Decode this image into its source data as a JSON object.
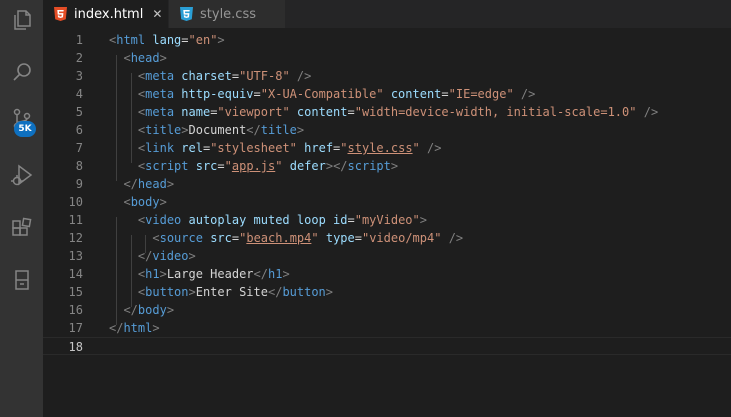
{
  "activity_bar": {
    "icons": [
      "explorer-icon",
      "search-icon",
      "source-control-icon",
      "run-debug-icon",
      "extensions-icon",
      "remote-explorer-icon"
    ],
    "source_control_badge": "5K"
  },
  "tabs": [
    {
      "label": "index.html",
      "icon": "html5-file-icon",
      "active": true,
      "icon_color": "#e44d26"
    },
    {
      "label": "style.css",
      "icon": "css3-file-icon",
      "active": false,
      "icon_color": "#2a9fd6"
    }
  ],
  "editor": {
    "current_line": 18,
    "lines": [
      {
        "n": "1",
        "tokens": [
          [
            "t-punc",
            "<"
          ],
          [
            "t-tag",
            "html"
          ],
          [
            "t-text",
            " "
          ],
          [
            "t-attr",
            "lang"
          ],
          [
            "t-text",
            "="
          ],
          [
            "t-str",
            "\"en\""
          ],
          [
            "t-punc",
            ">"
          ]
        ]
      },
      {
        "n": "2",
        "tokens": [
          [
            "t-text",
            "  "
          ],
          [
            "t-punc",
            "<"
          ],
          [
            "t-tag",
            "head"
          ],
          [
            "t-punc",
            ">"
          ]
        ]
      },
      {
        "n": "3",
        "tokens": [
          [
            "t-text",
            "    "
          ],
          [
            "t-punc",
            "<"
          ],
          [
            "t-tag",
            "meta"
          ],
          [
            "t-text",
            " "
          ],
          [
            "t-attr",
            "charset"
          ],
          [
            "t-text",
            "="
          ],
          [
            "t-str",
            "\"UTF-8\""
          ],
          [
            "t-text",
            " "
          ],
          [
            "t-punc",
            "/>"
          ]
        ]
      },
      {
        "n": "4",
        "tokens": [
          [
            "t-text",
            "    "
          ],
          [
            "t-punc",
            "<"
          ],
          [
            "t-tag",
            "meta"
          ],
          [
            "t-text",
            " "
          ],
          [
            "t-attr",
            "http-equiv"
          ],
          [
            "t-text",
            "="
          ],
          [
            "t-str",
            "\"X-UA-Compatible\""
          ],
          [
            "t-text",
            " "
          ],
          [
            "t-attr",
            "content"
          ],
          [
            "t-text",
            "="
          ],
          [
            "t-str",
            "\"IE=edge\""
          ],
          [
            "t-text",
            " "
          ],
          [
            "t-punc",
            "/>"
          ]
        ]
      },
      {
        "n": "5",
        "tokens": [
          [
            "t-text",
            "    "
          ],
          [
            "t-punc",
            "<"
          ],
          [
            "t-tag",
            "meta"
          ],
          [
            "t-text",
            " "
          ],
          [
            "t-attr",
            "name"
          ],
          [
            "t-text",
            "="
          ],
          [
            "t-str",
            "\"viewport\""
          ],
          [
            "t-text",
            " "
          ],
          [
            "t-attr",
            "content"
          ],
          [
            "t-text",
            "="
          ],
          [
            "t-str",
            "\"width=device-width, initial-scale=1.0\""
          ],
          [
            "t-text",
            " "
          ],
          [
            "t-punc",
            "/>"
          ]
        ]
      },
      {
        "n": "6",
        "tokens": [
          [
            "t-text",
            "    "
          ],
          [
            "t-punc",
            "<"
          ],
          [
            "t-tag",
            "title"
          ],
          [
            "t-punc",
            ">"
          ],
          [
            "t-text",
            "Document"
          ],
          [
            "t-punc",
            "</"
          ],
          [
            "t-tag",
            "title"
          ],
          [
            "t-punc",
            ">"
          ]
        ]
      },
      {
        "n": "7",
        "tokens": [
          [
            "t-text",
            "    "
          ],
          [
            "t-punc",
            "<"
          ],
          [
            "t-tag",
            "link"
          ],
          [
            "t-text",
            " "
          ],
          [
            "t-attr",
            "rel"
          ],
          [
            "t-text",
            "="
          ],
          [
            "t-str",
            "\"stylesheet\""
          ],
          [
            "t-text",
            " "
          ],
          [
            "t-attr",
            "href"
          ],
          [
            "t-text",
            "="
          ],
          [
            "t-str",
            "\""
          ],
          [
            "t-link",
            "style.css"
          ],
          [
            "t-str",
            "\""
          ],
          [
            "t-text",
            " "
          ],
          [
            "t-punc",
            "/>"
          ]
        ]
      },
      {
        "n": "8",
        "tokens": [
          [
            "t-text",
            "    "
          ],
          [
            "t-punc",
            "<"
          ],
          [
            "t-tag",
            "script"
          ],
          [
            "t-text",
            " "
          ],
          [
            "t-attr",
            "src"
          ],
          [
            "t-text",
            "="
          ],
          [
            "t-str",
            "\""
          ],
          [
            "t-link",
            "app.js"
          ],
          [
            "t-str",
            "\""
          ],
          [
            "t-text",
            " "
          ],
          [
            "t-attr",
            "defer"
          ],
          [
            "t-punc",
            "></"
          ],
          [
            "t-tag",
            "script"
          ],
          [
            "t-punc",
            ">"
          ]
        ]
      },
      {
        "n": "9",
        "tokens": [
          [
            "t-text",
            "  "
          ],
          [
            "t-punc",
            "</"
          ],
          [
            "t-tag",
            "head"
          ],
          [
            "t-punc",
            ">"
          ]
        ]
      },
      {
        "n": "10",
        "tokens": [
          [
            "t-text",
            "  "
          ],
          [
            "t-punc",
            "<"
          ],
          [
            "t-tag",
            "body"
          ],
          [
            "t-punc",
            ">"
          ]
        ]
      },
      {
        "n": "11",
        "tokens": [
          [
            "t-text",
            "    "
          ],
          [
            "t-punc",
            "<"
          ],
          [
            "t-tag",
            "video"
          ],
          [
            "t-text",
            " "
          ],
          [
            "t-attr",
            "autoplay"
          ],
          [
            "t-text",
            " "
          ],
          [
            "t-attr",
            "muted"
          ],
          [
            "t-text",
            " "
          ],
          [
            "t-attr",
            "loop"
          ],
          [
            "t-text",
            " "
          ],
          [
            "t-attr",
            "id"
          ],
          [
            "t-text",
            "="
          ],
          [
            "t-str",
            "\"myVideo\""
          ],
          [
            "t-punc",
            ">"
          ]
        ]
      },
      {
        "n": "12",
        "tokens": [
          [
            "t-text",
            "      "
          ],
          [
            "t-punc",
            "<"
          ],
          [
            "t-tag",
            "source"
          ],
          [
            "t-text",
            " "
          ],
          [
            "t-attr",
            "src"
          ],
          [
            "t-text",
            "="
          ],
          [
            "t-str",
            "\""
          ],
          [
            "t-link",
            "beach.mp4"
          ],
          [
            "t-str",
            "\""
          ],
          [
            "t-text",
            " "
          ],
          [
            "t-attr",
            "type"
          ],
          [
            "t-text",
            "="
          ],
          [
            "t-str",
            "\"video/mp4\""
          ],
          [
            "t-text",
            " "
          ],
          [
            "t-punc",
            "/>"
          ]
        ]
      },
      {
        "n": "13",
        "tokens": [
          [
            "t-text",
            "    "
          ],
          [
            "t-punc",
            "</"
          ],
          [
            "t-tag",
            "video"
          ],
          [
            "t-punc",
            ">"
          ]
        ]
      },
      {
        "n": "14",
        "tokens": [
          [
            "t-text",
            "    "
          ],
          [
            "t-punc",
            "<"
          ],
          [
            "t-tag",
            "h1"
          ],
          [
            "t-punc",
            ">"
          ],
          [
            "t-text",
            "Large Header"
          ],
          [
            "t-punc",
            "</"
          ],
          [
            "t-tag",
            "h1"
          ],
          [
            "t-punc",
            ">"
          ]
        ]
      },
      {
        "n": "15",
        "tokens": [
          [
            "t-text",
            "    "
          ],
          [
            "t-punc",
            "<"
          ],
          [
            "t-tag",
            "button"
          ],
          [
            "t-punc",
            ">"
          ],
          [
            "t-text",
            "Enter Site"
          ],
          [
            "t-punc",
            "</"
          ],
          [
            "t-tag",
            "button"
          ],
          [
            "t-punc",
            ">"
          ]
        ]
      },
      {
        "n": "16",
        "tokens": [
          [
            "t-text",
            "  "
          ],
          [
            "t-punc",
            "</"
          ],
          [
            "t-tag",
            "body"
          ],
          [
            "t-punc",
            ">"
          ]
        ]
      },
      {
        "n": "17",
        "tokens": [
          [
            "t-punc",
            "</"
          ],
          [
            "t-tag",
            "html"
          ],
          [
            "t-punc",
            ">"
          ]
        ]
      },
      {
        "n": "18",
        "tokens": []
      }
    ]
  }
}
